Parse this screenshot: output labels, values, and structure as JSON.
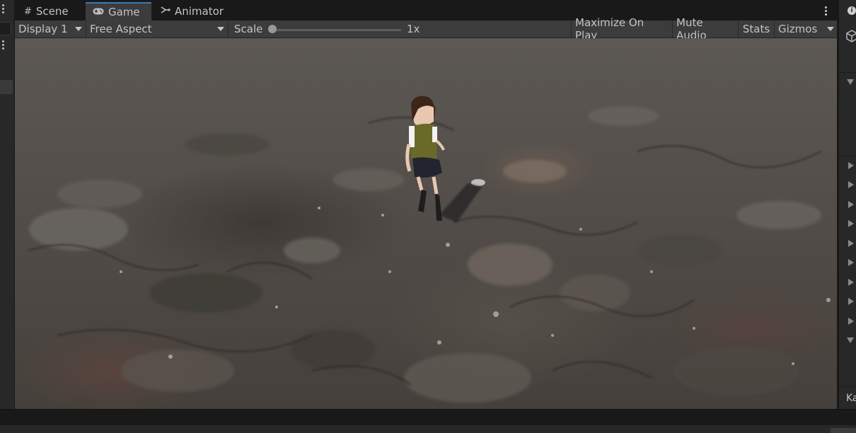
{
  "tabs": [
    {
      "label": "Scene",
      "icon": "grid-icon"
    },
    {
      "label": "Game",
      "icon": "gamepad-icon"
    },
    {
      "label": "Animator",
      "icon": "animator-icon"
    }
  ],
  "active_tab": "Game",
  "toolbar": {
    "display": "Display 1",
    "aspect": "Free Aspect",
    "scale_label": "Scale",
    "scale_value": "1x",
    "scale_level": 0,
    "maximize_label": "Maximize On Play",
    "mute_label": "Mute Audio",
    "stats_label": "Stats",
    "gizmos_label": "Gizmos"
  },
  "right_panel": {
    "bottom_label": "Ka"
  },
  "colors": {
    "active_tab_accent": "#3a79bb",
    "toolbar_bg": "#3c3c3c",
    "window_bg": "#191919"
  }
}
